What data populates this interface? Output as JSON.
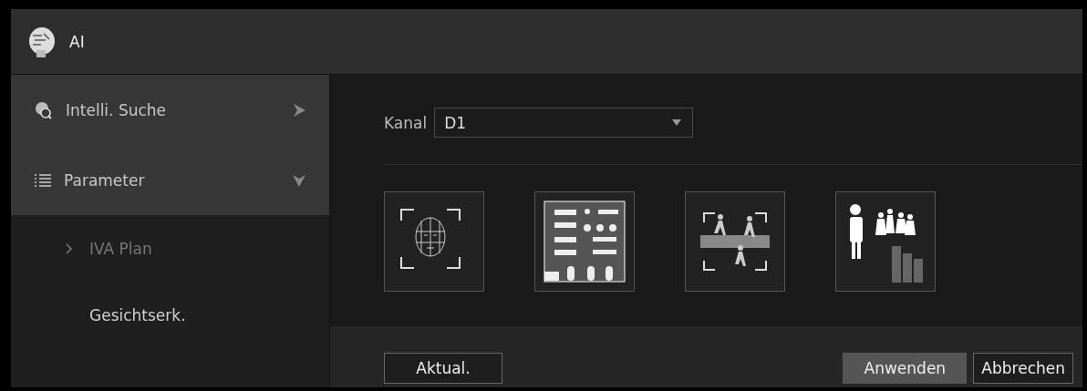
{
  "window": {
    "title": "AI"
  },
  "sidebar": {
    "items": [
      {
        "label": "Intelli. Suche",
        "kind": "section",
        "expanded": false
      },
      {
        "label": "Parameter",
        "kind": "section",
        "expanded": true
      },
      {
        "label": "IVA Plan",
        "kind": "sub",
        "selected": true,
        "disabled": true
      },
      {
        "label": "Gesichtserk.",
        "kind": "sub",
        "selected": false,
        "disabled": false
      }
    ]
  },
  "channel": {
    "label": "Kanal",
    "value": "D1"
  },
  "tiles": [
    {
      "kind": "face"
    },
    {
      "kind": "layout"
    },
    {
      "kind": "crossing"
    },
    {
      "kind": "crowd"
    }
  ],
  "buttons": [
    {
      "label": "Aktual.",
      "kind": "left",
      "primary": false
    },
    {
      "label": "Anwenden",
      "kind": "right",
      "primary": true
    },
    {
      "label": "Abbrechen",
      "kind": "right",
      "primary": false
    }
  ]
}
